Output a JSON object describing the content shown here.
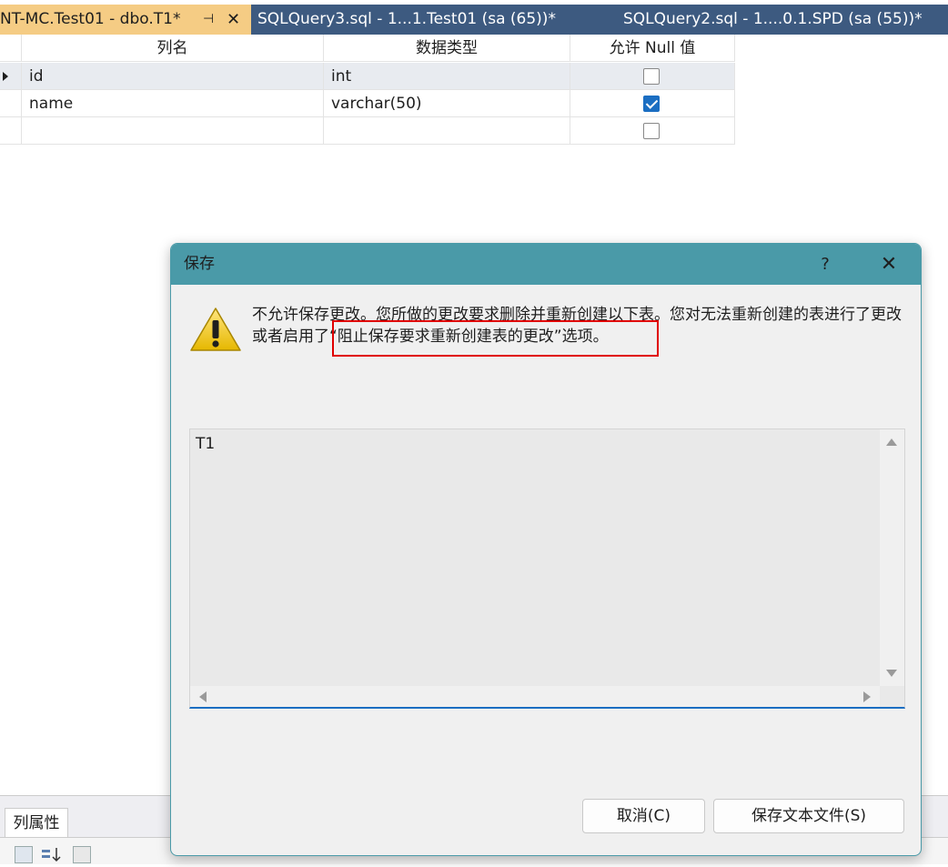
{
  "tabs": [
    {
      "title": "NT-MC.Test01 - dbo.T1*",
      "active": true
    },
    {
      "title": "SQLQuery3.sql - 1...1.Test01 (sa (65))*",
      "active": false
    },
    {
      "title": "SQLQuery2.sql - 1....0.1.SPD (sa (55))*",
      "active": false
    }
  ],
  "grid": {
    "headers": {
      "name": "列名",
      "type": "数据类型",
      "allow_null": "允许 Null 值"
    },
    "rows": [
      {
        "name": "id",
        "type": "int",
        "allow_null": false
      },
      {
        "name": "name",
        "type": "varchar(50)",
        "allow_null": true
      },
      {
        "name": "",
        "type": "",
        "allow_null": false
      }
    ]
  },
  "properties": {
    "tab_label": "列属性"
  },
  "dialog": {
    "title": "保存",
    "help": "?",
    "message": "不允许保存更改。您所做的更改要求删除并重新创建以下表。您对无法重新创建的表进行了更改或者启用了“阻止保存要求重新创建表的更改”选项。",
    "tables": [
      "T1"
    ],
    "buttons": {
      "cancel": "取消(C)",
      "save_text": "保存文本文件(S)"
    }
  },
  "colors": {
    "tab_strip": "#3d5a80",
    "active_tab": "#f5cc84",
    "dialog_title": "#4a9aa8",
    "highlight": "#e00000",
    "checkbox_checked": "#1b6ec2"
  }
}
